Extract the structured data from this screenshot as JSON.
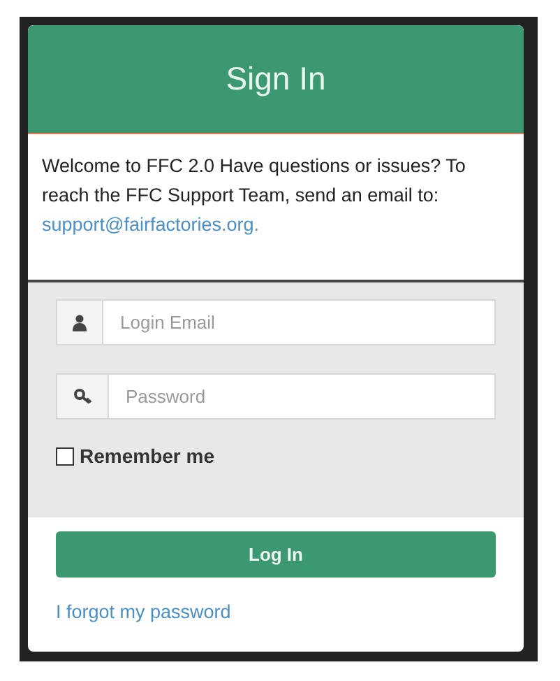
{
  "header": {
    "title": "Sign In"
  },
  "notice": {
    "text": "Welcome to FFC 2.0 Have questions or issues? To reach the FFC Support Team, send an email to:",
    "link": "support@fairfactories.org."
  },
  "fields": [
    {
      "kind": "email",
      "placeholder": "Login Email"
    },
    {
      "kind": "password",
      "placeholder": "Password"
    }
  ],
  "remember": {
    "label": "Remember me",
    "checked": false
  },
  "submit": {
    "label": "Log In"
  },
  "forgot": {
    "label": "I forgot my password"
  }
}
